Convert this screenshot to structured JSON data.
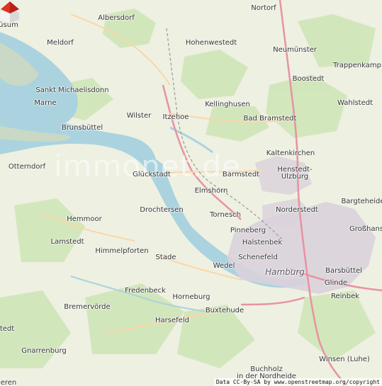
{
  "map": {
    "watermark": "immonet.de",
    "attribution": "Data CC-By-SA by www.openstreetmap.org/copyright",
    "marker_icon": "house-marker-icon",
    "colors": {
      "land": "#eef0e2",
      "forest": "#cfe6b8",
      "water": "#aad3df",
      "mudflat": "#c9d9c6",
      "urban": "#d9d2dc",
      "motorway": "#e892a2",
      "primary": "#fcd6a4",
      "railway": "#999999"
    },
    "places": [
      {
        "key": "ousum",
        "label": "üsum"
      },
      {
        "key": "albersdorf",
        "label": "Albersdorf"
      },
      {
        "key": "nortorf",
        "label": "Nortorf"
      },
      {
        "key": "meldorf",
        "label": "Meldorf"
      },
      {
        "key": "hohenwestedt",
        "label": "Hohenwestedt"
      },
      {
        "key": "neumuenster",
        "label": "Neumünster"
      },
      {
        "key": "trappenkamp",
        "label": "Trappenkamp"
      },
      {
        "key": "boostedt",
        "label": "Boostedt"
      },
      {
        "key": "sankt_michaelisdonn",
        "label": "Sankt Michaelisdonn"
      },
      {
        "key": "marne",
        "label": "Marne"
      },
      {
        "key": "kellinghusen",
        "label": "Kellinghusen"
      },
      {
        "key": "wahlstedt",
        "label": "Wahlstedt"
      },
      {
        "key": "wilster",
        "label": "Wilster"
      },
      {
        "key": "itzehoe",
        "label": "Itzehoe"
      },
      {
        "key": "bad_bramstedt",
        "label": "Bad Bramstedt"
      },
      {
        "key": "brunsbuettel",
        "label": "Brunsbüttel"
      },
      {
        "key": "kaltenkirchen",
        "label": "Kaltenkirchen"
      },
      {
        "key": "otterndorf",
        "label": "Otterndorf"
      },
      {
        "key": "glueckstadt",
        "label": "Glückstadt"
      },
      {
        "key": "barmstedt",
        "label": "Barmstedt"
      },
      {
        "key": "henstedt_ulzburg",
        "label": "Henstedt-\nUlzburg"
      },
      {
        "key": "elmshorn",
        "label": "Elmshorn"
      },
      {
        "key": "bargteheide",
        "label": "Bargteheide"
      },
      {
        "key": "drochtersen",
        "label": "Drochtersen"
      },
      {
        "key": "norderstedt",
        "label": "Norderstedt"
      },
      {
        "key": "hemmoor",
        "label": "Hemmoor"
      },
      {
        "key": "tornesch",
        "label": "Tornesch"
      },
      {
        "key": "grosshansdorf",
        "label": "Großhans"
      },
      {
        "key": "lamstedt",
        "label": "Lamstedt"
      },
      {
        "key": "pinneberg",
        "label": "Pinneberg"
      },
      {
        "key": "halstenbek",
        "label": "Halstenbek"
      },
      {
        "key": "himmelpforten",
        "label": "Himmelpforten"
      },
      {
        "key": "schenefeld",
        "label": "Schenefeld"
      },
      {
        "key": "stade",
        "label": "Stade"
      },
      {
        "key": "wedel",
        "label": "Wedel"
      },
      {
        "key": "hamburg",
        "label": "Hamburg"
      },
      {
        "key": "barsbuettel",
        "label": "Barsbüttel"
      },
      {
        "key": "glinde",
        "label": "Glinde"
      },
      {
        "key": "fredenbeck",
        "label": "Fredenbeck"
      },
      {
        "key": "horneburg",
        "label": "Horneburg"
      },
      {
        "key": "reinbek",
        "label": "Reinbek"
      },
      {
        "key": "bremervoerde",
        "label": "Bremervörde"
      },
      {
        "key": "buxtehude",
        "label": "Buxtehude"
      },
      {
        "key": "harsefeld",
        "label": "Harsefeld"
      },
      {
        "key": "stedt",
        "label": "tedt"
      },
      {
        "key": "gnarrenburg",
        "label": "Gnarrenburg"
      },
      {
        "key": "winsen",
        "label": "Winsen (Luhe)"
      },
      {
        "key": "buchholz",
        "label": "Buchholz\nin der Nordheide"
      },
      {
        "key": "eren",
        "label": "eren"
      }
    ]
  }
}
